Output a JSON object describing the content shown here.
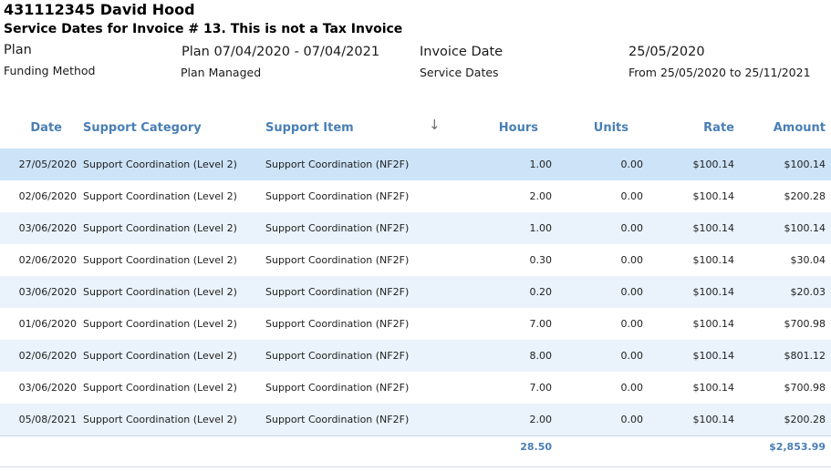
{
  "header": {
    "client_title": "431112345 David Hood",
    "subtitle": "Service Dates for Invoice # 13. This is not a Tax Invoice",
    "plan_label": "Plan",
    "plan_value": "Plan 07/04/2020 - 07/04/2021",
    "invoice_date_label": "Invoice Date",
    "invoice_date_value": "25/05/2020",
    "funding_method_label": "Funding Method",
    "funding_method_value": "Plan Managed",
    "service_dates_label": "Service Dates",
    "service_dates_value": "From 25/05/2020 to 25/11/2021"
  },
  "table": {
    "columns": {
      "date": "Date",
      "category": "Support Category",
      "item": "Support Item",
      "hours": "Hours",
      "units": "Units",
      "rate": "Rate",
      "amount": "Amount"
    },
    "sort_icon": "arrow-down-icon",
    "rows": [
      {
        "date": "27/05/2020",
        "category": "Support Coordination (Level 2)",
        "item": "Support Coordination (NF2F)",
        "hours": "1.00",
        "units": "0.00",
        "rate": "$100.14",
        "amount": "$100.14",
        "selected": true
      },
      {
        "date": "02/06/2020",
        "category": "Support Coordination (Level 2)",
        "item": "Support Coordination (NF2F)",
        "hours": "2.00",
        "units": "0.00",
        "rate": "$100.14",
        "amount": "$200.28"
      },
      {
        "date": "03/06/2020",
        "category": "Support Coordination (Level 2)",
        "item": "Support Coordination (NF2F)",
        "hours": "1.00",
        "units": "0.00",
        "rate": "$100.14",
        "amount": "$100.14"
      },
      {
        "date": "02/06/2020",
        "category": "Support Coordination (Level 2)",
        "item": "Support Coordination (NF2F)",
        "hours": "0.30",
        "units": "0.00",
        "rate": "$100.14",
        "amount": "$30.04"
      },
      {
        "date": "03/06/2020",
        "category": "Support Coordination (Level 2)",
        "item": "Support Coordination (NF2F)",
        "hours": "0.20",
        "units": "0.00",
        "rate": "$100.14",
        "amount": "$20.03"
      },
      {
        "date": "01/06/2020",
        "category": "Support Coordination (Level 2)",
        "item": "Support Coordination (NF2F)",
        "hours": "7.00",
        "units": "0.00",
        "rate": "$100.14",
        "amount": "$700.98"
      },
      {
        "date": "02/06/2020",
        "category": "Support Coordination (Level 2)",
        "item": "Support Coordination (NF2F)",
        "hours": "8.00",
        "units": "0.00",
        "rate": "$100.14",
        "amount": "$801.12"
      },
      {
        "date": "03/06/2020",
        "category": "Support Coordination (Level 2)",
        "item": "Support Coordination (NF2F)",
        "hours": "7.00",
        "units": "0.00",
        "rate": "$100.14",
        "amount": "$700.98"
      },
      {
        "date": "05/08/2021",
        "category": "Support Coordination (Level 2)",
        "item": "Support Coordination (NF2F)",
        "hours": "2.00",
        "units": "0.00",
        "rate": "$100.14",
        "amount": "$200.28"
      }
    ],
    "totals": {
      "hours": "28.50",
      "amount": "$2,853.99"
    }
  },
  "colors": {
    "header_text": "#4a7fb5",
    "alt_row": "#eaf3fb",
    "selected_row": "#cce3f8"
  }
}
